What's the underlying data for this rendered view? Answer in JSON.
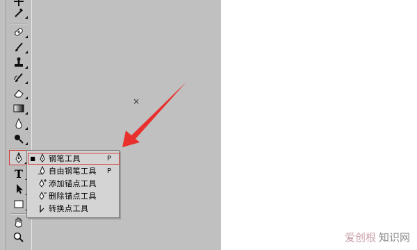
{
  "menu": {
    "items": [
      {
        "bullet": "■",
        "label": "钢笔工具",
        "shortcut": "P",
        "icon": "pen-icon",
        "selected": true
      },
      {
        "bullet": "",
        "label": "自由钢笔工具",
        "shortcut": "P",
        "icon": "freeform-pen-icon",
        "selected": false
      },
      {
        "bullet": "",
        "label": "添加锚点工具",
        "shortcut": "",
        "icon": "add-anchor-point-icon",
        "selected": false
      },
      {
        "bullet": "",
        "label": "删除锚点工具",
        "shortcut": "",
        "icon": "delete-anchor-point-icon",
        "selected": false
      },
      {
        "bullet": "",
        "label": "转换点工具",
        "shortcut": "",
        "icon": "convert-point-icon",
        "selected": false
      }
    ]
  },
  "toolbar": {
    "tools": [
      "move-icon",
      "eyedropper-icon",
      "healing-brush-icon",
      "brush-icon",
      "clone-stamp-icon",
      "history-brush-icon",
      "eraser-icon",
      "gradient-icon",
      "blur-icon",
      "dodge-icon",
      "pen-icon",
      "type-icon",
      "path-selection-icon",
      "rectangle-icon",
      "hand-icon",
      "zoom-icon"
    ],
    "type_glyph": "T"
  },
  "canvas": {
    "cursor_glyph": "×"
  },
  "watermark": {
    "part1": "爱创根",
    "part2": "知识网"
  },
  "colors": {
    "workspace": "#c0c0c0",
    "toolbar": "#bdbdbd",
    "highlight": "#d23a3a",
    "arrow": "#e8302d",
    "menu": "#d4d4d4"
  }
}
